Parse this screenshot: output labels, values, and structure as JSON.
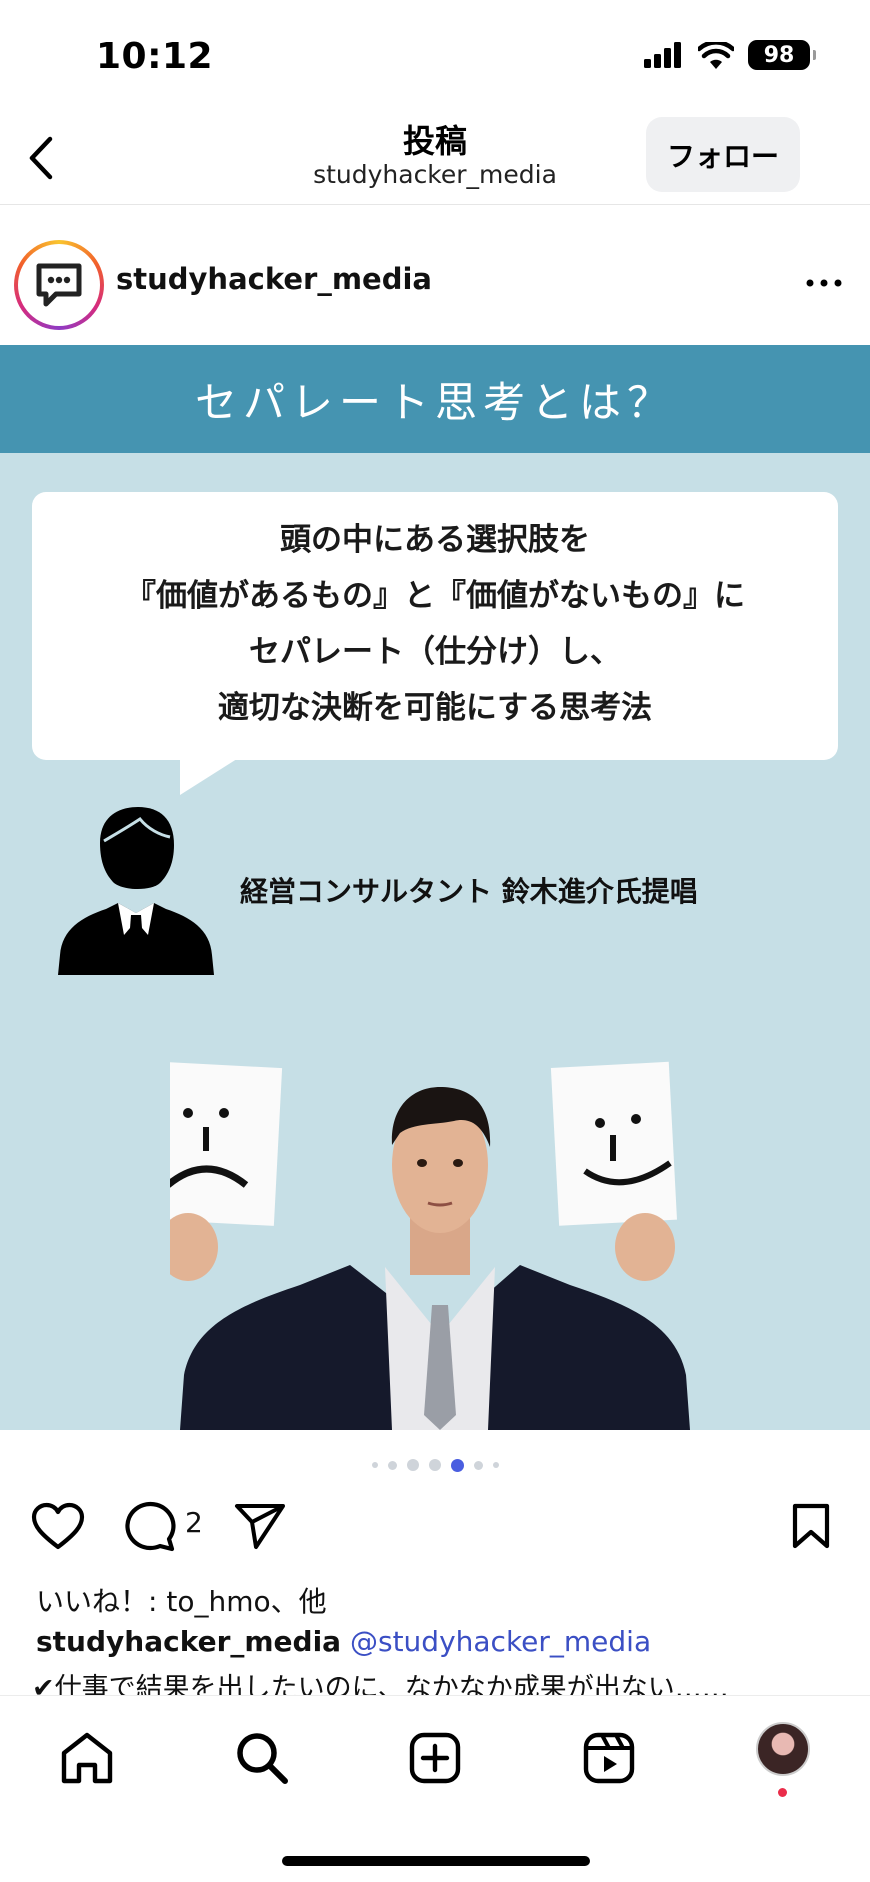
{
  "status_bar": {
    "time": "10:12",
    "battery": "98",
    "icons": [
      "signal-icon",
      "wifi-icon",
      "battery-icon"
    ]
  },
  "header": {
    "title": "投稿",
    "subtitle": "studyhacker_media",
    "follow_label": "フォロー"
  },
  "post": {
    "username": "studyhacker_media",
    "image": {
      "banner_title": "セパレート思考とは？",
      "bubble_lines": [
        "頭の中にある選択肢を",
        "『価値があるもの』と『価値がないもの』に",
        "セパレート（仕分け）し、",
        "適切な決断を可能にする思考法"
      ],
      "consultant_label": "経営コンサルタント 鈴木進介氏提唱"
    },
    "carousel": {
      "total": 7,
      "active_index": 4
    },
    "comment_count": "2",
    "likes_text": "いいね！: to_hmo、他",
    "caption_user": "studyhacker_media",
    "caption_mention": "@studyhacker_media",
    "caption_text": "✔仕事で結果を出したいのに、なかなか成果が出ない……"
  },
  "tab_bar": {
    "items": [
      "home-icon",
      "search-icon",
      "create-icon",
      "reels-icon",
      "profile-avatar"
    ]
  },
  "colors": {
    "banner": "#4594b1",
    "image_bg": "#c6dfe6",
    "mention": "#3b4fc4",
    "active_dot": "#4a5ee0"
  }
}
